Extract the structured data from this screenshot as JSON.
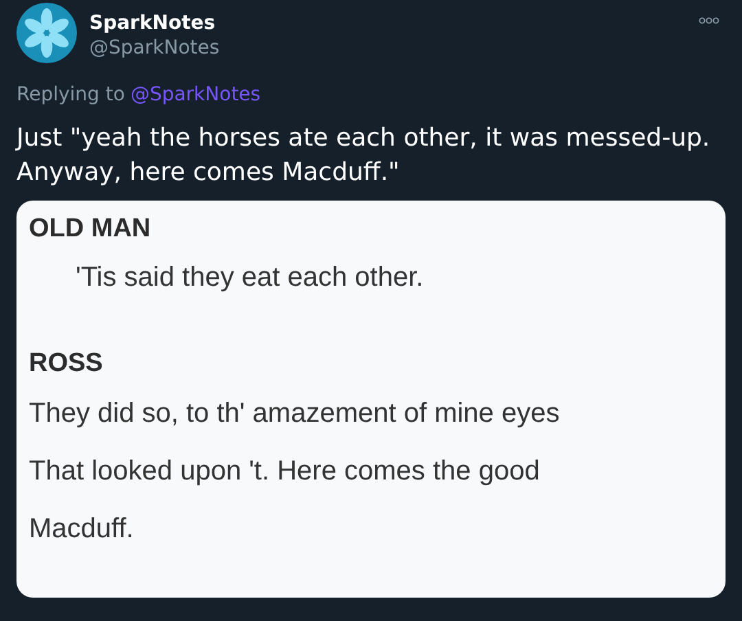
{
  "author": {
    "name": "SparkNotes",
    "handle": "@SparkNotes"
  },
  "reply": {
    "prefix": "Replying to",
    "mention": "@SparkNotes"
  },
  "text_lines": [
    "Just \"yeah the horses ate each other, it was messed-up.",
    "Anyway, here comes Macduff.\""
  ],
  "image": {
    "speeches": [
      {
        "speaker": "OLD MAN",
        "indented": true,
        "lines": [
          "'Tis said they eat each other."
        ]
      },
      {
        "speaker": "ROSS",
        "indented": false,
        "lines": [
          "They did so, to th' amazement of mine eyes",
          "That looked upon 't. Here comes the good",
          "Macduff."
        ]
      }
    ]
  }
}
